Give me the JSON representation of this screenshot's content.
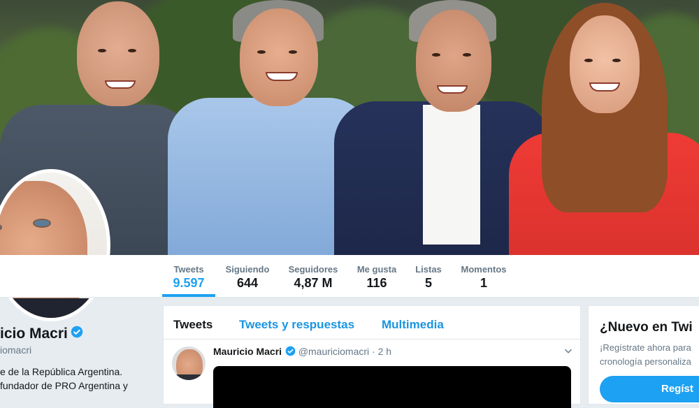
{
  "stats": [
    {
      "label": "Tweets",
      "value": "9.597",
      "active": true
    },
    {
      "label": "Siguiendo",
      "value": "644"
    },
    {
      "label": "Seguidores",
      "value": "4,87 M"
    },
    {
      "label": "Me gusta",
      "value": "116"
    },
    {
      "label": "Listas",
      "value": "5"
    },
    {
      "label": "Momentos",
      "value": "1"
    }
  ],
  "profile": {
    "name": "icio Macri",
    "handle": "iomacri",
    "bio_line1": "e de la República Argentina.",
    "bio_line2": "fundador de PRO Argentina y"
  },
  "timeline": {
    "tabs": [
      "Tweets",
      "Tweets y respuestas",
      "Multimedia"
    ],
    "tweet": {
      "name": "Mauricio Macri",
      "handle": "@mauriciomacri",
      "separator": "·",
      "time": "2 h"
    }
  },
  "signup": {
    "title": "¿Nuevo en Twi",
    "text_line1": "¡Regístrate ahora para",
    "text_line2": "cronología personaliza",
    "button": "Regíst"
  },
  "colors": {
    "accent": "#1da1f2",
    "link": "#1b95e0",
    "text_primary": "#14171a",
    "text_secondary": "#657786"
  },
  "icons": {
    "verified": "verified-badge-icon",
    "caret": "chevron-down-icon"
  }
}
